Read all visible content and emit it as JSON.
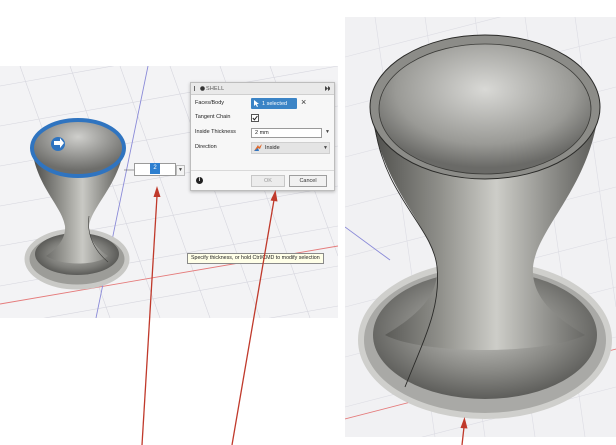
{
  "shell_dialog": {
    "title": "SHELL",
    "rows": [
      {
        "label": "Faces/Body",
        "value": "1 selected"
      },
      {
        "label": "Tangent Chain",
        "checked": true
      },
      {
        "label": "Inside Thickness",
        "value": "2 mm"
      },
      {
        "label": "Direction",
        "value": "Inside"
      }
    ],
    "ok_label": "OK",
    "cancel_label": "Cancel"
  },
  "inline_input": {
    "value": "2"
  },
  "tooltip": "Specify thickness, or hold Ctrl/CMD to modify selection",
  "colors": {
    "selection_blue": "#2f74c0",
    "annotation_arrow": "#c0392b",
    "grid_red": "#e57b7b",
    "grid_blue": "#8a8ad8"
  },
  "icons": [
    "collapse-icon",
    "expand-arrows-icon",
    "cursor-select-icon",
    "close-icon",
    "checkbox-checked-icon",
    "dropdown-arrow-icon",
    "direction-arrows-icon",
    "info-icon",
    "rotate-handle-icon"
  ]
}
